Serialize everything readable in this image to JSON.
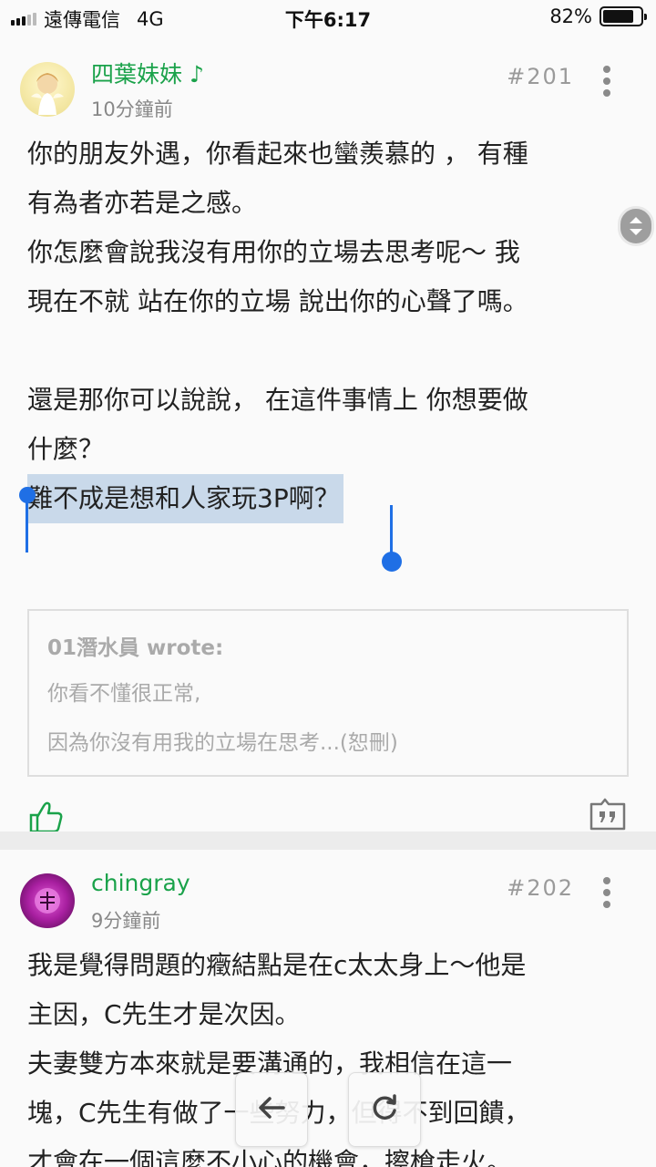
{
  "status_bar": {
    "carrier": "遠傳電信",
    "network": "4G",
    "time": "下午6:17",
    "battery": "82%",
    "battery_level": 0.82,
    "signal_bars_on": 3,
    "signal_bars_total": 5
  },
  "posts": [
    {
      "username": "四葉妹妹 ♪",
      "time_ago": "10分鐘前",
      "floor": "#201",
      "lines": [
        "你的朋友外遇，你看起來也蠻羨慕的 ， 有種",
        "有為者亦若是之感。",
        "你怎麼會說我沒有用你的立場去思考呢～ 我",
        "現在不就 站在你的立場 說出你的心聲了嗎。",
        "",
        "還是那你可以說說， 在這件事情上 你想要做",
        "什麼？"
      ],
      "highlighted_line": "難不成是想和人家玩3P啊？",
      "quote": {
        "author": "01潛水員 wrote:",
        "lines": [
          "你看不懂很正常,",
          "因為你沒有用我的立場在思考...(恕刪)"
        ]
      }
    },
    {
      "username": "chingray",
      "time_ago": "9分鐘前",
      "floor": "#202",
      "lines": [
        "我是覺得問題的癥結點是在c太太身上～他是",
        "主因，C先生才是次因。",
        "夫妻雙方本來就是要溝通的，我相信在這一",
        "塊，C先生有做了一些努力，但得不到回饋，",
        "才會在一個這麼不小心的機會，擦槍走火。"
      ]
    }
  ],
  "icons": {
    "like": "thumbs-up-icon",
    "reply": "quote-reply-icon",
    "more": "more-vertical-icon",
    "back": "arrow-left-icon",
    "refresh": "refresh-icon"
  },
  "colors": {
    "username": "#1aa24a",
    "selection": "#1f6fe5",
    "highlight": "#c9d9ea"
  }
}
